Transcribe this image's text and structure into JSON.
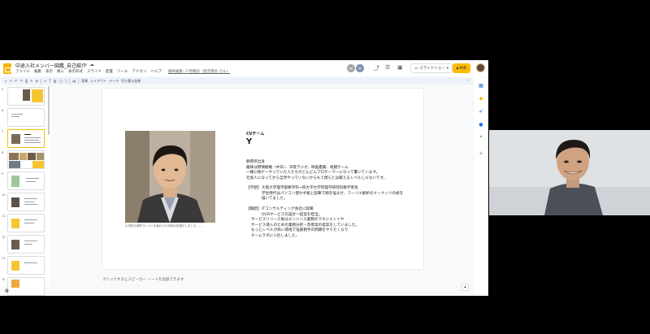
{
  "app": {
    "doc_title": "中途入社メンバー図鑑_自己紹介",
    "menu": [
      "ファイル",
      "編集",
      "表示",
      "挿入",
      "表示形式",
      "スライド",
      "配置",
      "ツール",
      "アドオン",
      "ヘルプ"
    ],
    "last_edit": "最終編集: 2 時間前（金宮健太 さん）",
    "collaborators": [
      "HE",
      "M"
    ],
    "slideshow_label": "スライドショー",
    "share_label": "共有",
    "toolbar_items": [
      "背景",
      "レイアウト",
      "テーマ",
      "切り替え効果"
    ],
    "colors": {
      "accent": "#fbbc04",
      "logo": "#f4b400"
    }
  },
  "filmstrip": {
    "slide_numbers": [
      "5",
      "6",
      "7",
      "8",
      "9",
      "10",
      "11",
      "12",
      "13",
      "14"
    ],
    "selected_index": 2
  },
  "slide": {
    "team_label": "CVチーム",
    "initial": "Y",
    "caption": "小学校の頃学ラーメンを食わされ気味な記憶がしました。。。",
    "intro": [
      "静岡県出身",
      "趣味は野球観戦（中日）、深夜ラジオ、映画鑑賞、格闘ゲーム",
      "一緒に格ゲーやっていた人たちがどんどんプロゲーマーになって驚いています。",
      "社会人になってから全然やっていないからもう僕らとは戦えるレベルじゃないです。"
    ],
    "education_heading": "【学歴】",
    "education": [
      "大阪大学理学部数学科→同大学大学院理学研究科数学専攻",
      "学生時代はパソコン使わず紙と鉛筆で頭を悩ませ、フーリエ解析のドーナッツの絵を",
      "描いてました。"
    ],
    "career_heading": "【職歴】",
    "career": [
      "ITコンサルティング会社に就職",
      "OCRサービスの設計〜提案を担当。",
      "サービスリリース後はエンハンス業務のマネジメントや",
      "サービス導入のための業務分析・改善案の提案をしていました。",
      "もっとレベルが高い環境で強豪相手の問題をやりたくなり",
      "チームラボに入社しました。"
    ]
  },
  "notes": {
    "placeholder": "クリックするとスピーカー ノートを追加できます"
  }
}
